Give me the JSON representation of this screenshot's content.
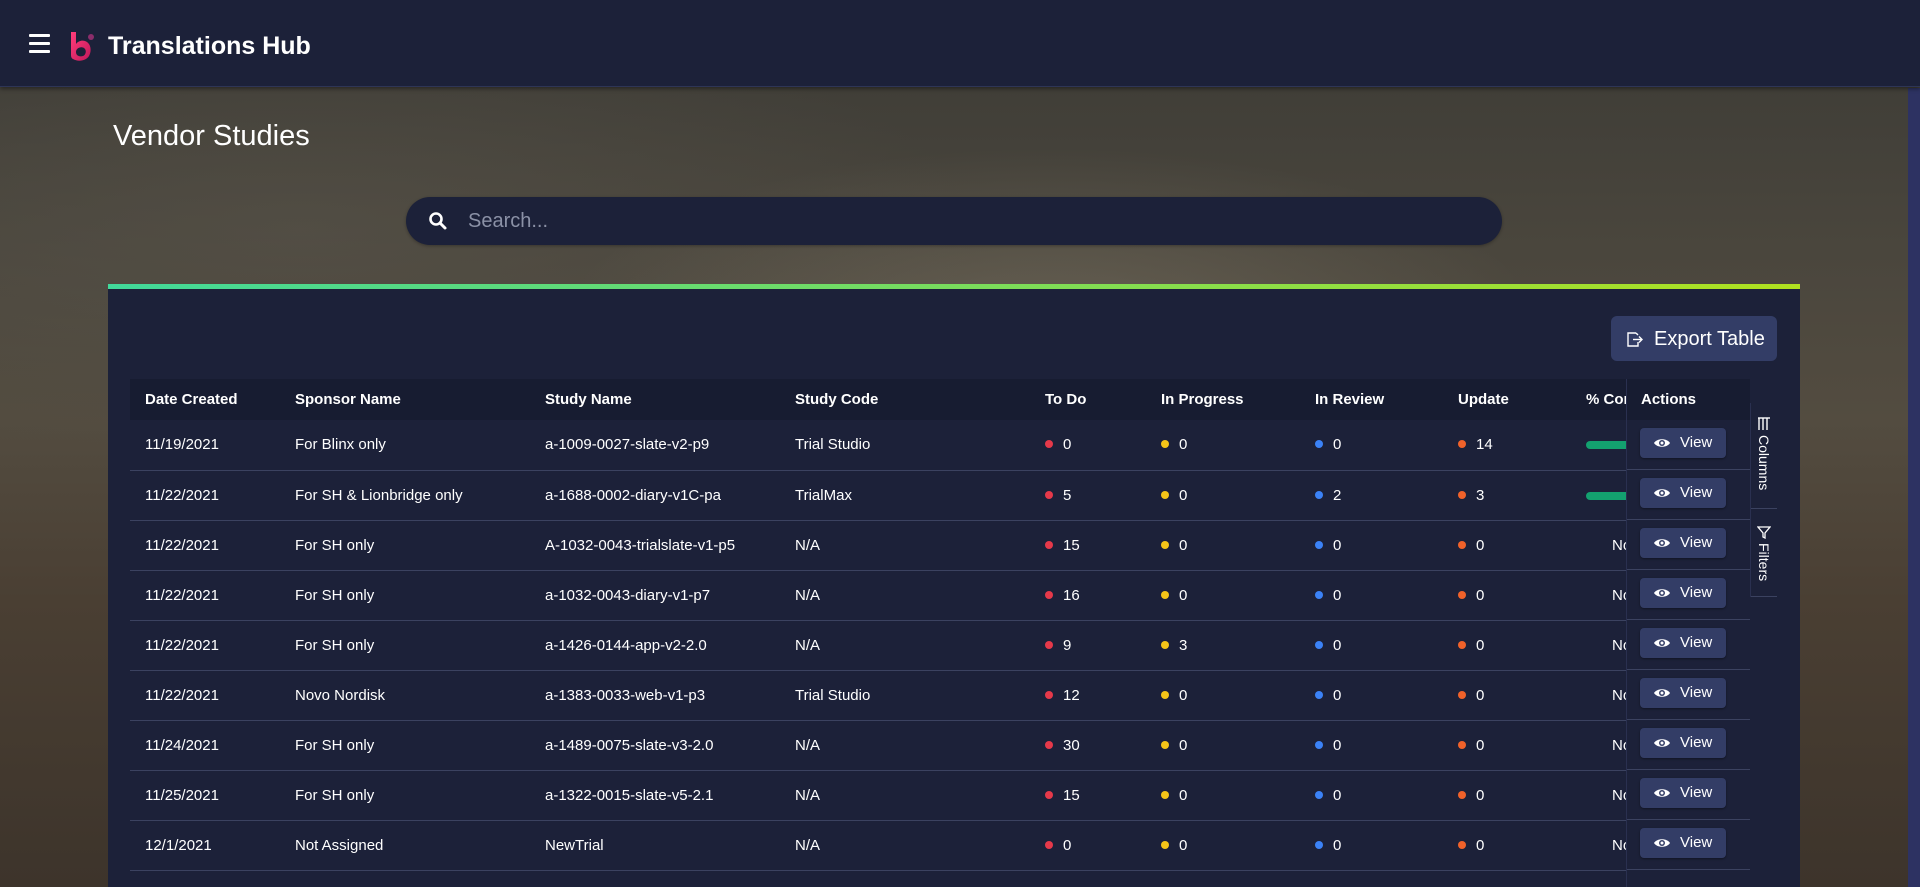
{
  "header": {
    "app_title": "Translations Hub",
    "menu_icon": "hamburger-menu-icon",
    "logo_icon": "b-logo-icon"
  },
  "page": {
    "title": "Vendor Studies"
  },
  "search": {
    "placeholder": "Search...",
    "value": "",
    "icon": "search-icon"
  },
  "toolbar": {
    "export_label": "Export Table",
    "export_icon": "export-icon"
  },
  "table": {
    "columns": [
      "Date Created",
      "Sponsor Name",
      "Study Name",
      "Study Code",
      "To Do",
      "In Progress",
      "In Review",
      "Update",
      "% Cor",
      "Actions"
    ],
    "status_colors": {
      "todo": "#e5394a",
      "in_progress": "#f5c518",
      "in_review": "#3b82f6",
      "update": "#f0622a"
    },
    "rows": [
      {
        "date": "11/19/2021",
        "sponsor": "For Blinx only",
        "study": "a-1009-0027-slate-v2-p9",
        "code": "Trial Studio",
        "todo": "0",
        "in_progress": "0",
        "in_review": "0",
        "update": "14",
        "pct_text": "",
        "pct_fill": 0.35,
        "action": "View"
      },
      {
        "date": "11/22/2021",
        "sponsor": "For SH & Lionbridge only",
        "study": "a-1688-0002-diary-v1C-pa",
        "code": "TrialMax",
        "todo": "5",
        "in_progress": "0",
        "in_review": "2",
        "update": "3",
        "pct_text": "",
        "pct_fill": 0.35,
        "action": "View"
      },
      {
        "date": "11/22/2021",
        "sponsor": "For SH only",
        "study": "A-1032-0043-trialslate-v1-p5",
        "code": "N/A",
        "todo": "15",
        "in_progress": "0",
        "in_review": "0",
        "update": "0",
        "pct_text": "No",
        "pct_fill": 0,
        "action": "View"
      },
      {
        "date": "11/22/2021",
        "sponsor": "For SH only",
        "study": "a-1032-0043-diary-v1-p7",
        "code": "N/A",
        "todo": "16",
        "in_progress": "0",
        "in_review": "0",
        "update": "0",
        "pct_text": "No",
        "pct_fill": 0,
        "action": "View"
      },
      {
        "date": "11/22/2021",
        "sponsor": "For SH only",
        "study": "a-1426-0144-app-v2-2.0",
        "code": "N/A",
        "todo": "9",
        "in_progress": "3",
        "in_review": "0",
        "update": "0",
        "pct_text": "No",
        "pct_fill": 0,
        "action": "View"
      },
      {
        "date": "11/22/2021",
        "sponsor": "Novo Nordisk",
        "study": "a-1383-0033-web-v1-p3",
        "code": "Trial Studio",
        "todo": "12",
        "in_progress": "0",
        "in_review": "0",
        "update": "0",
        "pct_text": "No",
        "pct_fill": 0,
        "action": "View"
      },
      {
        "date": "11/24/2021",
        "sponsor": "For SH only",
        "study": "a-1489-0075-slate-v3-2.0",
        "code": "N/A",
        "todo": "30",
        "in_progress": "0",
        "in_review": "0",
        "update": "0",
        "pct_text": "No",
        "pct_fill": 0,
        "action": "View"
      },
      {
        "date": "11/25/2021",
        "sponsor": "For SH only",
        "study": "a-1322-0015-slate-v5-2.1",
        "code": "N/A",
        "todo": "15",
        "in_progress": "0",
        "in_review": "0",
        "update": "0",
        "pct_text": "No",
        "pct_fill": 0,
        "action": "View"
      },
      {
        "date": "12/1/2021",
        "sponsor": "Not Assigned",
        "study": "NewTrial",
        "code": "N/A",
        "todo": "0",
        "in_progress": "0",
        "in_review": "0",
        "update": "0",
        "pct_text": "No",
        "pct_fill": 0,
        "action": "View"
      }
    ]
  },
  "side_panel": {
    "columns_label": "Columns",
    "filters_label": "Filters",
    "columns_icon": "columns-icon",
    "filters_icon": "filter-icon"
  }
}
